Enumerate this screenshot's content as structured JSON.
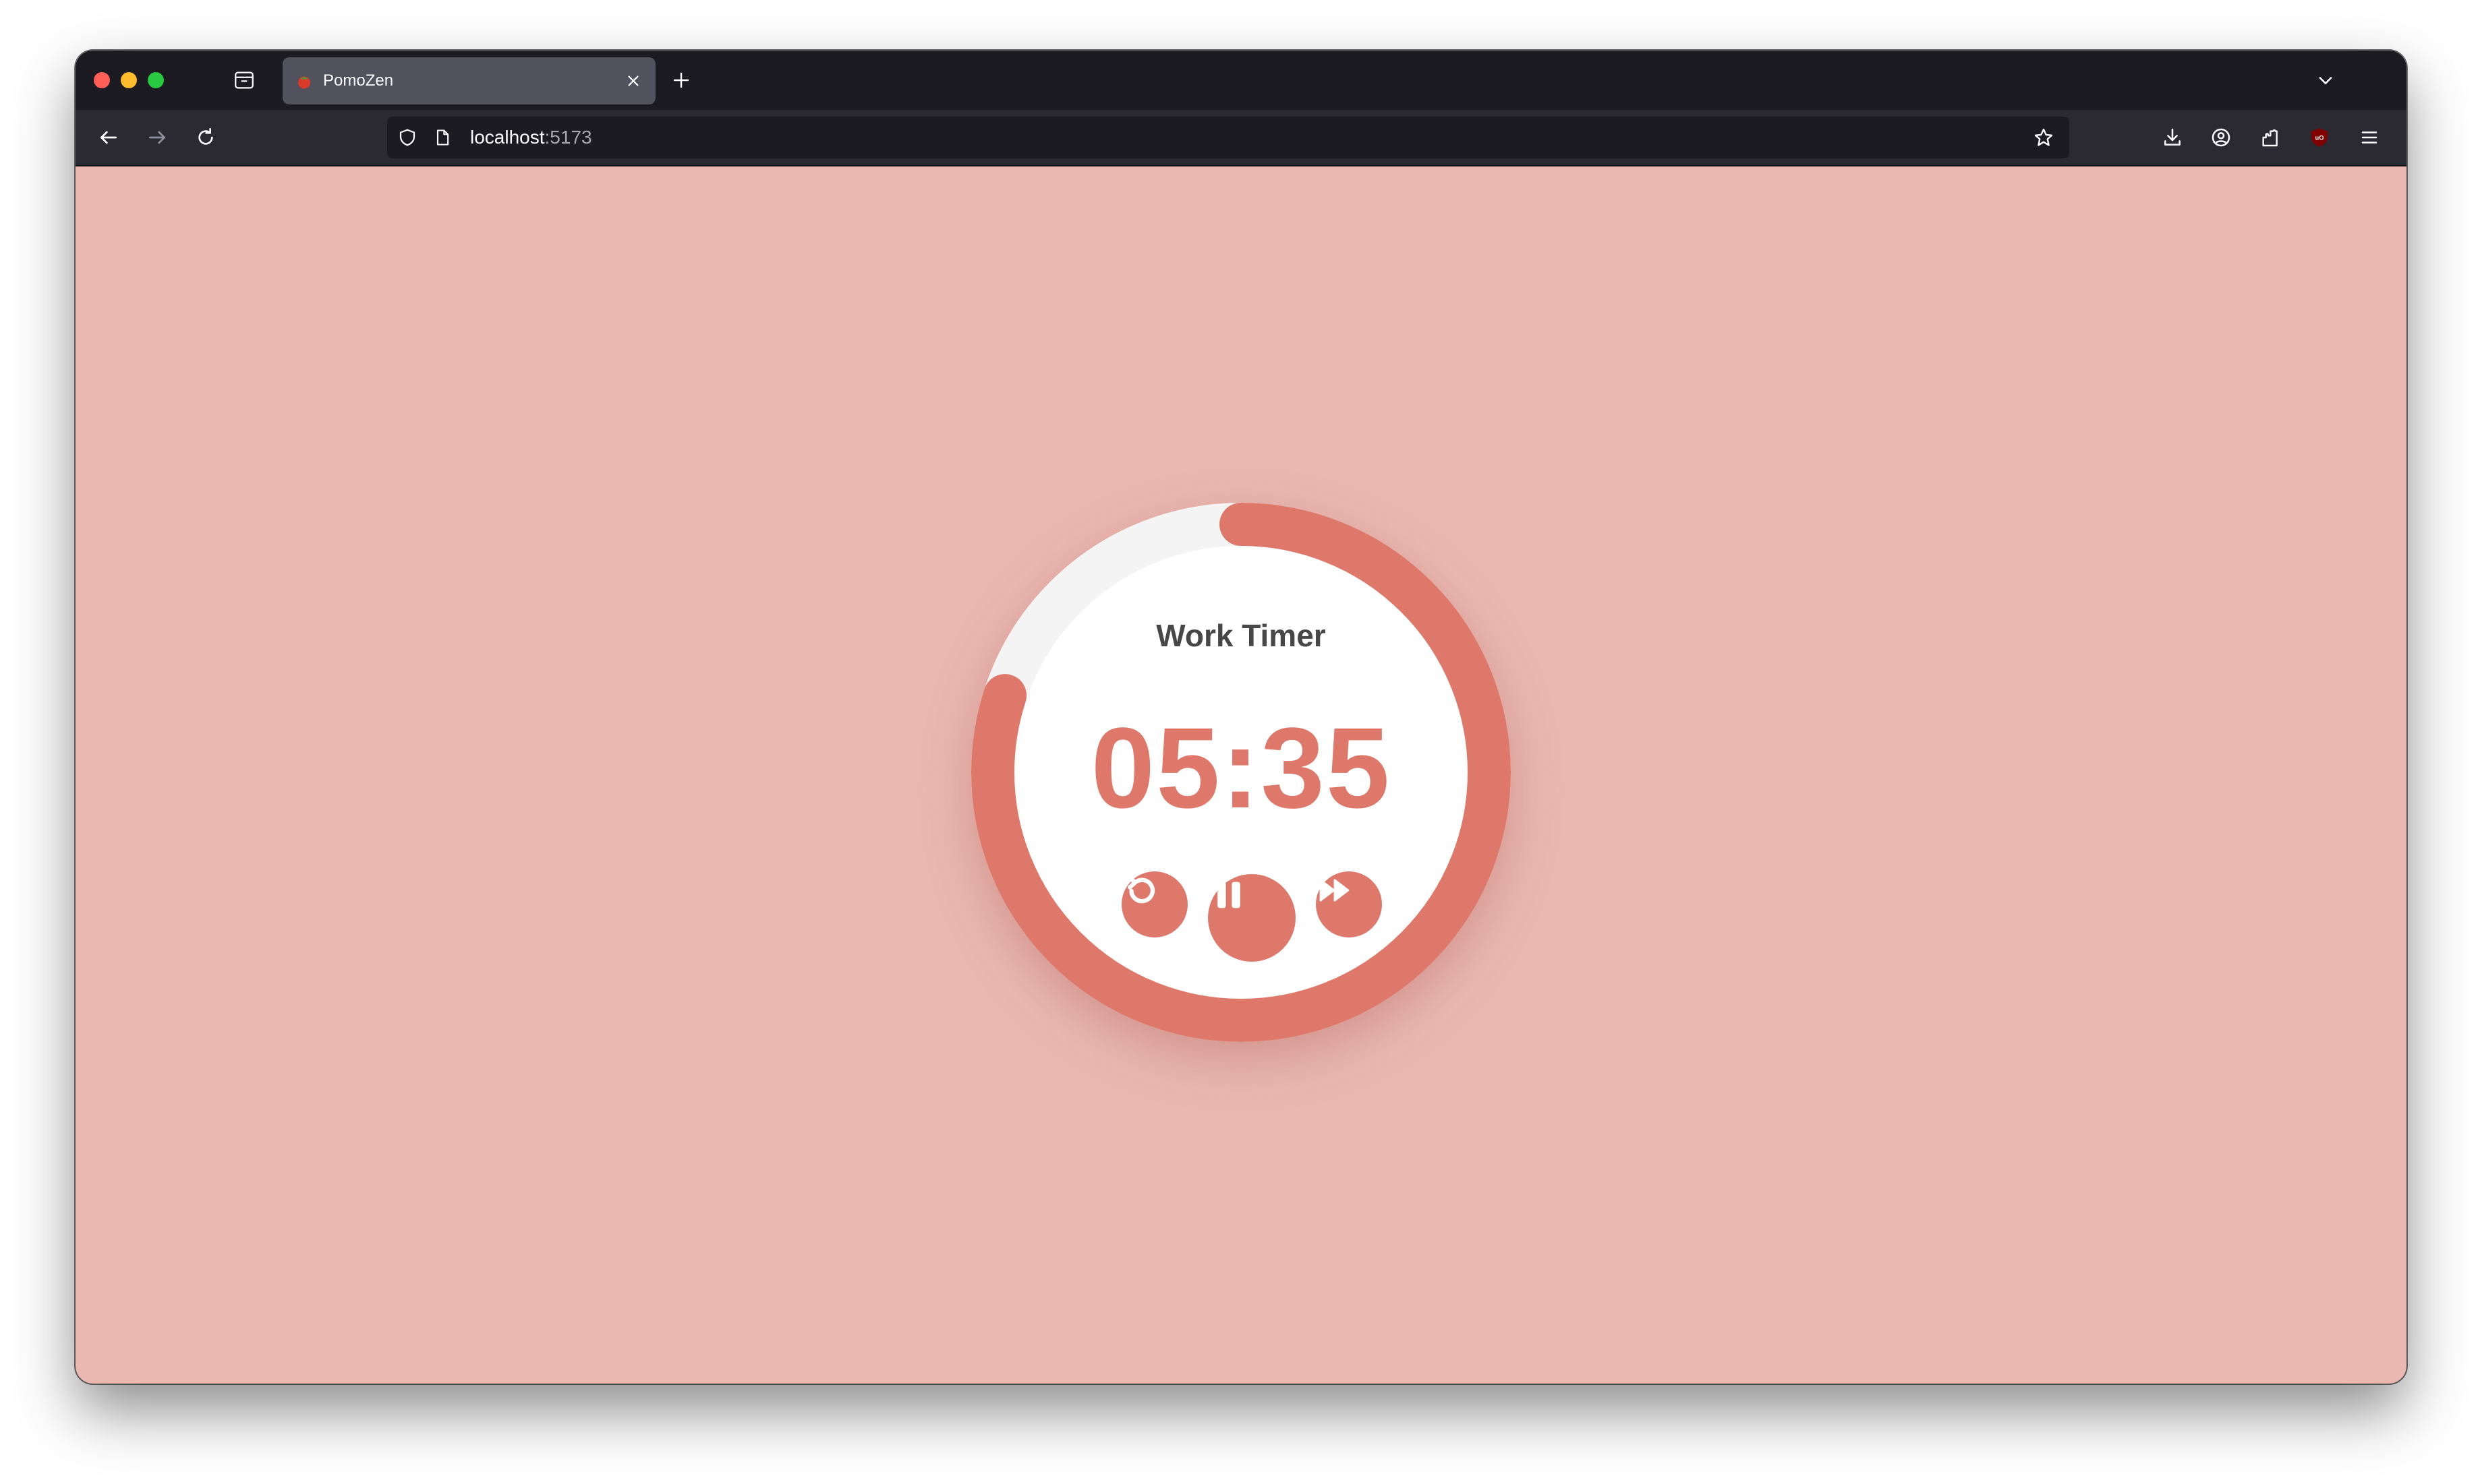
{
  "browser": {
    "tab": {
      "title": "PomoZen",
      "favicon": "tomato-icon"
    },
    "address": {
      "host": "localhost",
      "port": ":5173"
    },
    "icons": [
      "firefox-view-icon",
      "new-tab-icon",
      "tab-list-icon",
      "back-icon",
      "forward-icon",
      "reload-icon",
      "shield-icon",
      "page-icon",
      "bookmark-star-icon",
      "downloads-icon",
      "account-icon",
      "extensions-icon",
      "ublock-icon",
      "menu-icon"
    ]
  },
  "timer": {
    "label": "Work Timer",
    "time": "05:35",
    "progress_fraction": 0.8,
    "colors": {
      "page_background": "#eab7b1",
      "accent": "#de786b",
      "track": "#f4f4f4",
      "face": "#ffffff",
      "label_text": "#474747"
    },
    "controls": [
      "reset-icon",
      "pause-icon",
      "skip-forward-icon"
    ]
  }
}
